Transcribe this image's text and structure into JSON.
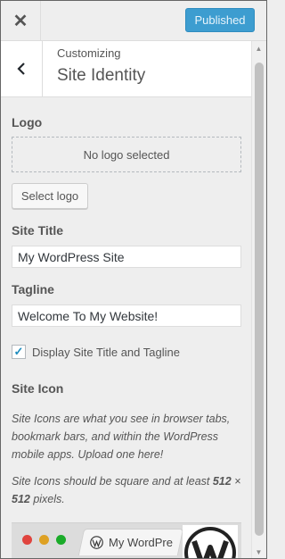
{
  "header": {
    "close_icon": "close-icon",
    "publish_label": "Published"
  },
  "section": {
    "crumb": "Customizing",
    "title": "Site Identity",
    "back_icon": "chevron-left-icon"
  },
  "logo": {
    "label": "Logo",
    "empty_text": "No logo selected",
    "select_button": "Select logo"
  },
  "site_title": {
    "label": "Site Title",
    "value": "My WordPress Site"
  },
  "tagline": {
    "label": "Tagline",
    "value": "Welcome To My Website!"
  },
  "display_toggle": {
    "label": "Display Site Title and Tagline",
    "checked": true
  },
  "site_icon": {
    "label": "Site Icon",
    "desc1": "Site Icons are what you see in browser tabs, bookmark bars, and within the WordPress mobile apps. Upload one here!",
    "desc2_prefix": "Site Icons should be square and at least ",
    "desc2_size1": "512",
    "desc2_mid": " × ",
    "desc2_size2": "512",
    "desc2_suffix": " pixels."
  },
  "preview": {
    "tab_title": "My WordPre",
    "colors": {
      "red": "#e0443e",
      "yellow": "#dea123",
      "green": "#1aab29"
    }
  },
  "colors": {
    "accent": "#3d9dd0",
    "panel_bg": "#eeeeee"
  }
}
